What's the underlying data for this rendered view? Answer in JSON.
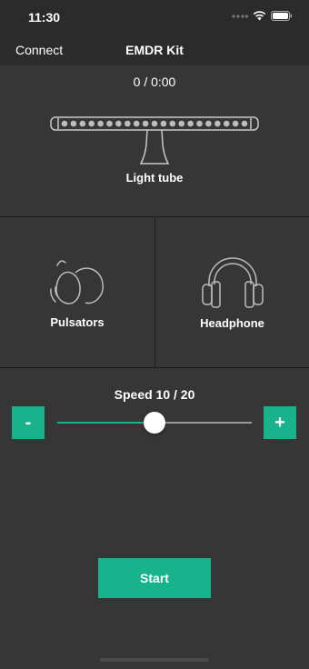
{
  "status_bar": {
    "time": "11:30"
  },
  "nav": {
    "left_label": "Connect",
    "title": "EMDR Kit"
  },
  "light_tube": {
    "counter": "0 / 0:00",
    "label": "Light tube"
  },
  "devices": {
    "pulsators_label": "Pulsators",
    "headphone_label": "Headphone"
  },
  "speed": {
    "label": "Speed 10 / 20",
    "value": 10,
    "max": 20,
    "minus_label": "-",
    "plus_label": "+"
  },
  "actions": {
    "start_label": "Start"
  },
  "colors": {
    "accent": "#18b38c",
    "background": "#363636",
    "bar": "#2b2b2b"
  },
  "icons": [
    "signal-dots-icon",
    "wifi-icon",
    "battery-icon",
    "light-tube-icon",
    "pulsators-icon",
    "headphone-icon"
  ]
}
